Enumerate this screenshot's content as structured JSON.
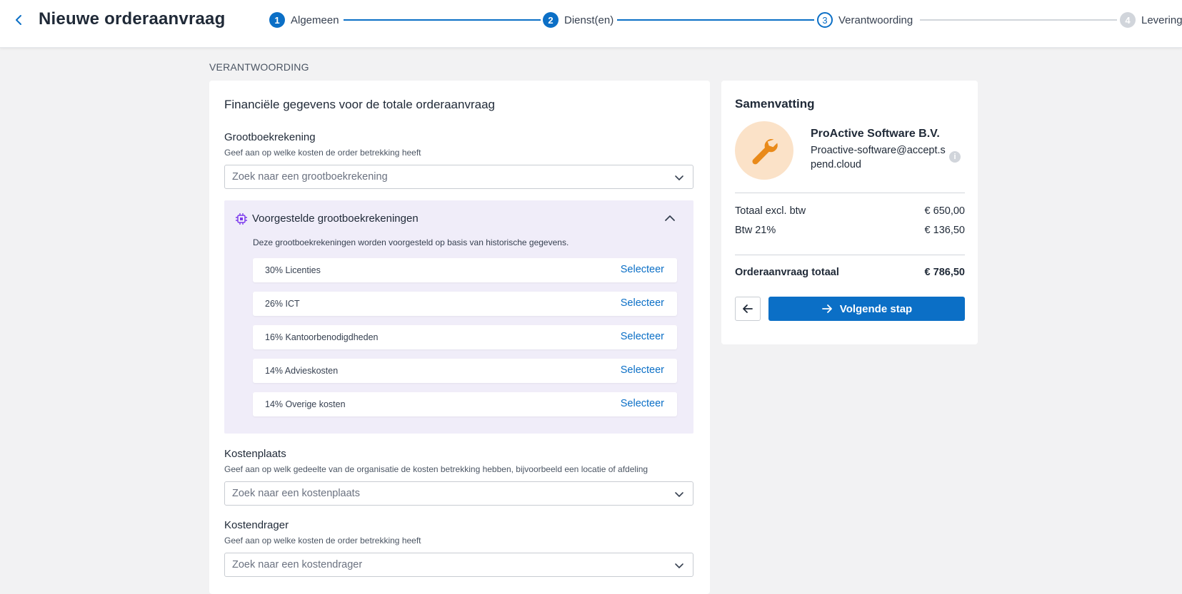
{
  "header": {
    "title": "Nieuwe orderaanvraag",
    "steps": [
      {
        "number": "1",
        "label": "Algemeen",
        "state": "done"
      },
      {
        "number": "2",
        "label": "Dienst(en)",
        "state": "done"
      },
      {
        "number": "3",
        "label": "Verantwoording",
        "state": "current"
      },
      {
        "number": "4",
        "label": "Levering",
        "state": "todo"
      }
    ]
  },
  "section": {
    "label": "VERANTWOORDING"
  },
  "financial": {
    "heading": "Financiële gegevens voor de totale orderaanvraag",
    "ledger": {
      "title": "Grootboekrekening",
      "help": "Geef aan op welke kosten de order betrekking heeft",
      "placeholder": "Zoek naar een grootboekrekening"
    },
    "suggestions": {
      "title": "Voorgestelde grootboekrekeningen",
      "description": "Deze grootboekrekeningen worden voorgesteld op basis van historische gegevens.",
      "select_label": "Selecteer",
      "items": [
        {
          "label": "30% Licenties"
        },
        {
          "label": "26% ICT"
        },
        {
          "label": "16% Kantoorbenodigdheden"
        },
        {
          "label": "14% Advieskosten"
        },
        {
          "label": "14% Overige kosten"
        }
      ]
    },
    "cost_center": {
      "title": "Kostenplaats",
      "help": "Geef aan op welk gedeelte van de organisatie de kosten betrekking hebben, bijvoorbeeld een locatie of afdeling",
      "placeholder": "Zoek naar een kostenplaats"
    },
    "cost_unit": {
      "title": "Kostendrager",
      "help": "Geef aan op welke kosten de order betrekking heeft",
      "placeholder": "Zoek naar een kostendrager"
    }
  },
  "summary": {
    "title": "Samenvatting",
    "vendor": {
      "name": "ProActive Software B.V.",
      "email": "Proactive-software@accept.spend.cloud",
      "icon": "wrench-icon"
    },
    "rows": [
      {
        "label": "Totaal excl. btw",
        "value": "€ 650,00"
      },
      {
        "label": "Btw 21%",
        "value": "€ 136,50"
      }
    ],
    "total": {
      "label": "Orderaanvraag totaal",
      "value": "€ 786,50"
    },
    "next_button": "Volgende stap"
  },
  "colors": {
    "primary": "#0b6fc6",
    "suggest_bg": "#f0edf9",
    "avatar_bg": "#fbe2c8",
    "wrench": "#e98a1a",
    "ai_icon": "#7c3aed"
  }
}
